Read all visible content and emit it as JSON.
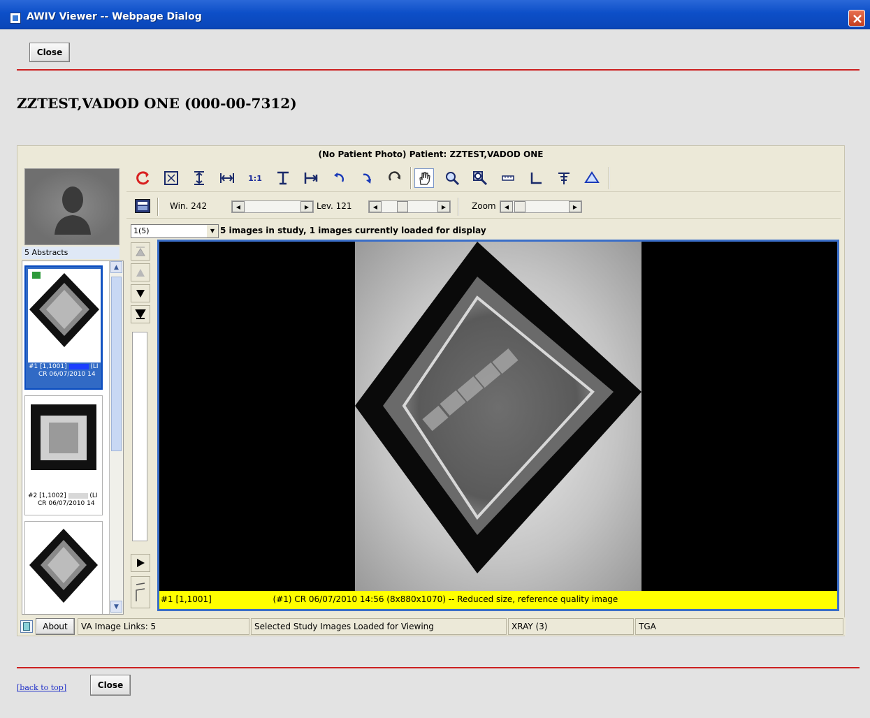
{
  "window": {
    "title": "AWIV Viewer -- Webpage Dialog"
  },
  "top": {
    "close_label": "Close"
  },
  "patient": {
    "heading": "ZZTEST,VADOD ONE (000-00-7312)"
  },
  "viewer": {
    "header": "(No Patient Photo) Patient: ZZTEST,VADOD ONE",
    "abstracts_label": "5 Abstracts",
    "thumbnails": [
      {
        "line1": "#1 [1,1001]",
        "line2": "CR 06/07/2010 14",
        "suffix": "(LI"
      },
      {
        "line1": "#2 [1,1002]",
        "line2": "CR 06/07/2010 14",
        "suffix": "(LI"
      },
      {
        "line1": "",
        "line2": "",
        "suffix": ""
      }
    ],
    "toolbar": {
      "win_label": "Win. 242",
      "lev_label": "Lev. 121",
      "zoom_label": "Zoom"
    },
    "image_select": "1(5)",
    "info_text": "5 images in study, 1 images currently loaded for display",
    "image_caption_left": "#1 [1,1001]",
    "image_caption_right": "(#1) CR 06/07/2010 14:56 (8x880x1070) -- Reduced size, reference quality image",
    "status": {
      "about": "About",
      "links": "VA Image Links: 5",
      "loaded": "Selected Study Images Loaded for Viewing",
      "modality": "XRAY (3)",
      "format": "TGA"
    }
  },
  "bottom": {
    "back_to_top": "[back to top]",
    "close_label": "Close"
  },
  "colors": {
    "accent_red": "#cc2020",
    "title_blue": "#0d4fc8",
    "selection_blue": "#316ac5",
    "caption_yellow": "#ffff00"
  }
}
